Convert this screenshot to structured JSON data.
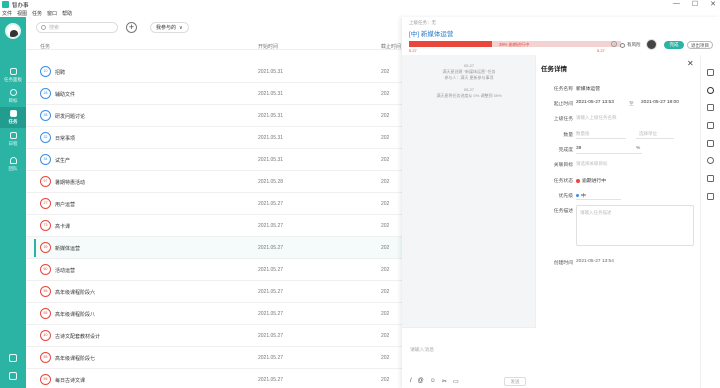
{
  "app": {
    "title": "智办事",
    "menu": [
      "文件",
      "视图",
      "任务",
      "窗口",
      "帮助"
    ]
  },
  "window": {
    "minimize": "—",
    "maximize": "☐",
    "close": "✕"
  },
  "nav": {
    "items": [
      {
        "label": "任务面板",
        "name": "nav-task-board"
      },
      {
        "label": "目标",
        "name": "nav-goals"
      },
      {
        "label": "任务",
        "name": "nav-tasks"
      },
      {
        "label": "日程",
        "name": "nav-schedule"
      },
      {
        "label": "团队",
        "name": "nav-team"
      }
    ]
  },
  "list": {
    "search_placeholder": "搜索",
    "add": "+",
    "filter_label": "我参与的",
    "filter_caret": "∨",
    "col_task": "任务",
    "col_start": "开始时间",
    "col_deadline": "截止时间",
    "rows": [
      {
        "progress": "10",
        "color": "blue",
        "name": "招聘",
        "start": "2021.05.31",
        "end": "202"
      },
      {
        "progress": "28",
        "color": "blue",
        "name": "辅助文件",
        "start": "2021.05.31",
        "end": "202"
      },
      {
        "progress": "38",
        "color": "blue",
        "name": "研发问题讨论",
        "start": "2021.05.31",
        "end": "202"
      },
      {
        "progress": "32",
        "color": "blue",
        "name": "日常事项",
        "start": "2021.05.31",
        "end": "202"
      },
      {
        "progress": "34",
        "color": "blue",
        "name": "试生产",
        "start": "2021.05.31",
        "end": "202"
      },
      {
        "progress": "97",
        "color": "red",
        "name": "暑期特惠活动",
        "start": "2021.05.28",
        "end": "202"
      },
      {
        "progress": "27",
        "color": "red",
        "name": "用户运营",
        "start": "2021.05.27",
        "end": "202"
      },
      {
        "progress": "73",
        "color": "red",
        "name": "高卡课",
        "start": "2021.05.27",
        "end": "202"
      },
      {
        "progress": "39",
        "color": "red",
        "name": "新媒体运营",
        "start": "2021.05.27",
        "end": "202"
      },
      {
        "progress": "60",
        "color": "red",
        "name": "活动运营",
        "start": "2021.05.27",
        "end": "202"
      },
      {
        "progress": "55",
        "color": "red",
        "name": "高年级课程阶段六",
        "start": "2021.05.27",
        "end": "202"
      },
      {
        "progress": "55",
        "color": "red",
        "name": "高年级课程阶段八",
        "start": "2021.05.27",
        "end": "202"
      },
      {
        "progress": "40",
        "color": "red",
        "name": "古诗文配套教材设计",
        "start": "2021.05.27",
        "end": "202"
      },
      {
        "progress": "55",
        "color": "red",
        "name": "高年级课程阶段七",
        "start": "2021.05.27",
        "end": "202"
      },
      {
        "progress": "55",
        "color": "red",
        "name": "每日古诗文课",
        "start": "2021.05.27",
        "end": "202"
      }
    ],
    "selected_index": 8
  },
  "detail": {
    "parent_label": "上级任务：无",
    "title": "[中] 新媒体运营",
    "progress_value": 0.39,
    "progress_text": "39% 逾期进行中",
    "date_left": "5.27",
    "date_right": "5.27",
    "help": "?",
    "risk_label": "有风险",
    "finish_button": "完成",
    "exit_button": "退出项目",
    "menu_dots": "···",
    "log": [
      {
        "time": "05-27",
        "lines": [
          "满天星创建 \"新媒体运营\" 任务",
          "参与人：满天  更新参与事项"
        ]
      },
      {
        "time": "05-27",
        "lines": [
          "满天星将任务进度从 0% 调整到 39%"
        ]
      }
    ],
    "chat_placeholder": "请输入消息",
    "chat_tools": [
      "/",
      "@",
      "☺",
      "✂",
      "▭"
    ],
    "chat_send": "发送",
    "collapse": "»",
    "form": {
      "title": "任务详情",
      "close": "✕",
      "fields": {
        "name_label": "任务名称",
        "name_value": "新媒体运营",
        "time_label": "起止时间",
        "time_start": "2021-05-27 13:53",
        "time_sep": "至",
        "time_end": "2021-05-27 18:00",
        "parent_label": "上级任务",
        "parent_placeholder": "请输入上级任务名称",
        "qty_label": "数量",
        "qty_placeholder": "数量值",
        "unit_placeholder": "选择单位",
        "percent_label": "完成度",
        "percent_value": "39",
        "percent_unit": "%",
        "goal_label": "关联目标",
        "goal_placeholder": "请选择关联目标",
        "status_label": "任务状态",
        "status_value": "逾期进行中",
        "priority_label": "优先级",
        "priority_value": "中",
        "desc_label": "任务描述",
        "desc_placeholder": "请输入任务描述",
        "created_label": "创建时间",
        "created_value": "2021-05-27 13:54"
      }
    }
  }
}
